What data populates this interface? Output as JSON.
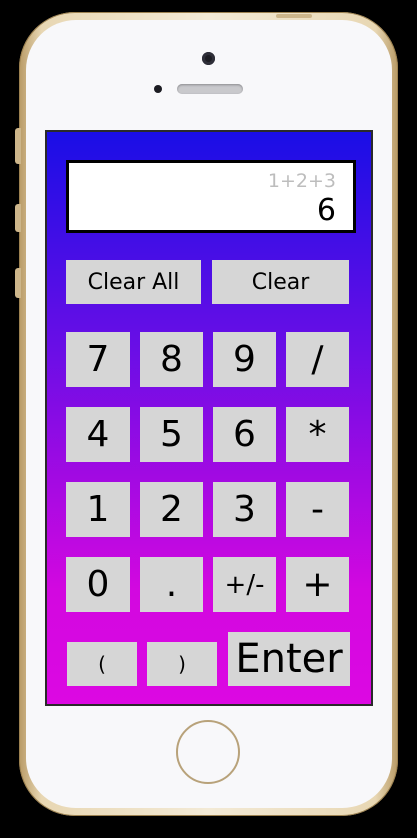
{
  "display": {
    "expression": "1+2+3",
    "result": "6"
  },
  "clear_row": [
    {
      "label": "Clear All"
    },
    {
      "label": "Clear"
    }
  ],
  "keypad": [
    {
      "label": "7"
    },
    {
      "label": "8"
    },
    {
      "label": "9"
    },
    {
      "label": "/"
    },
    {
      "label": "4"
    },
    {
      "label": "5"
    },
    {
      "label": "6"
    },
    {
      "label": "*"
    },
    {
      "label": "1"
    },
    {
      "label": "2"
    },
    {
      "label": "3"
    },
    {
      "label": "-"
    },
    {
      "label": "0"
    },
    {
      "label": "."
    },
    {
      "label": "+/-"
    },
    {
      "label": "+"
    }
  ],
  "bottom_row": {
    "open_paren": "(",
    "close_paren": ")",
    "enter": "Enter"
  },
  "colors": {
    "screen_top": "#1a0ee6",
    "screen_bottom": "#dc08e2",
    "button": "#d6d6d6",
    "expression_text": "#bdbdbd"
  }
}
